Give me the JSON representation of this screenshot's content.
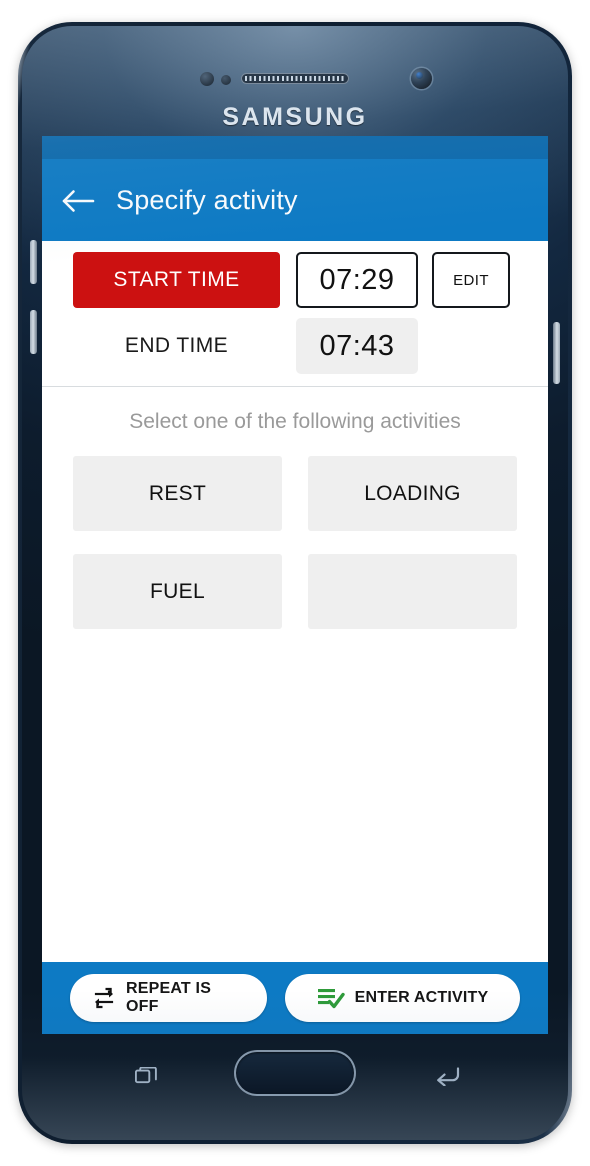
{
  "device": {
    "brand_logo": "SAMSUNG",
    "hardware": {
      "earpiece": "earpiece-speaker",
      "proximity_sensor": "proximity-sensor",
      "light_sensor": "light-sensor",
      "front_camera": "front-camera",
      "home_button": "home-button",
      "recents_key": "recents-icon",
      "back_key": "back-icon",
      "volume_up": "volume-up-key",
      "volume_down": "volume-down-key",
      "power": "power-key"
    }
  },
  "colors": {
    "status_bar": "#0b69ac",
    "app_bar": "#0d7ac4",
    "accent_blue": "#0d7ac4",
    "start_time_red": "#cc1111",
    "button_gray": "#efefef",
    "hint_gray": "#9a9a9a",
    "check_green": "#2f9b3a"
  },
  "app_bar": {
    "back_icon": "back-arrow-icon",
    "title": "Specify activity"
  },
  "time_section": {
    "start": {
      "label": "START TIME",
      "value": "07:29",
      "edit_label": "EDIT"
    },
    "end": {
      "label": "END TIME",
      "value": "07:43"
    }
  },
  "activity_section": {
    "hint": "Select one of the following activities",
    "buttons": [
      {
        "label": "REST",
        "empty": false
      },
      {
        "label": "LOADING",
        "empty": false
      },
      {
        "label": "FUEL",
        "empty": false
      },
      {
        "label": "",
        "empty": true
      }
    ]
  },
  "bottom_bar": {
    "repeat": {
      "icon": "repeat-icon",
      "label": "REPEAT IS OFF"
    },
    "enter": {
      "icon": "enter-activity-icon",
      "label": "ENTER ACTIVITY"
    }
  }
}
